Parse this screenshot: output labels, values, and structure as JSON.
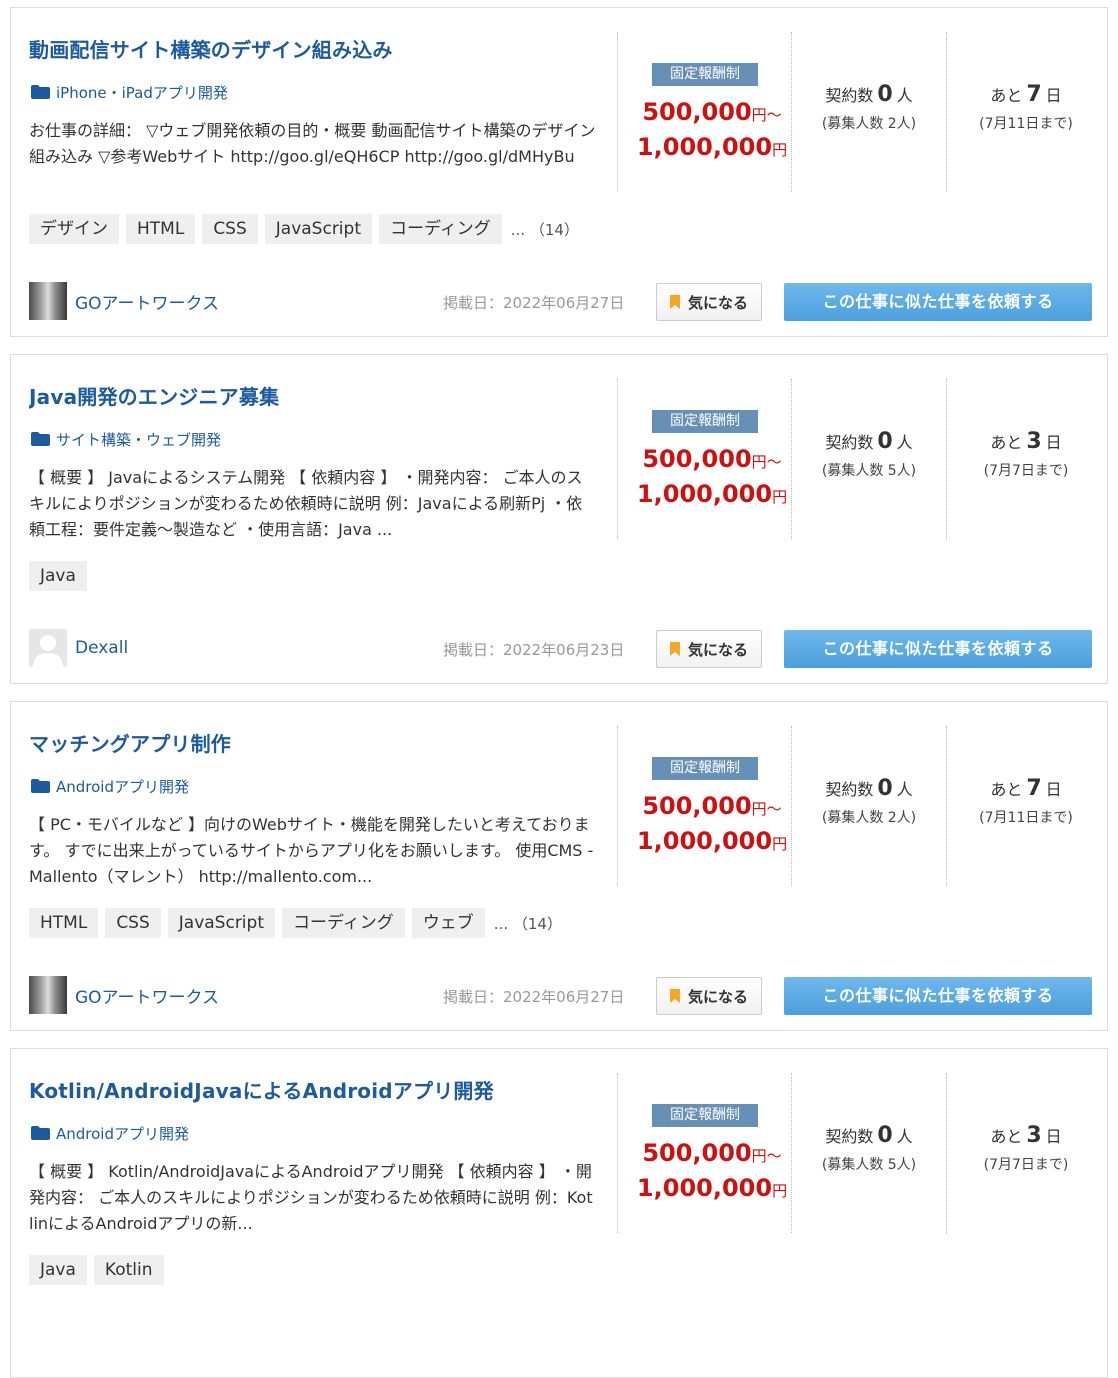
{
  "common": {
    "fee_type": "固定報酬制",
    "price_min": "500,000",
    "price_max": "1,000,000",
    "yen": "円",
    "tilde": "～",
    "contracts_label": "契約数",
    "people_unit": "人",
    "remaining_prefix": "あと",
    "days_unit": "日",
    "favorite_label": "気になる",
    "request_similar_label": "この仕事に似た仕事を依頼する"
  },
  "jobs": [
    {
      "title": "動画配信サイト構築のデザイン組み込み",
      "category": "iPhone・iPadアプリ開発",
      "description": "お仕事の詳細： ▽ウェブ開発依頼の目的・概要 動画配信サイト構築のデザイン組み込み ▽参考Webサイト http://goo.gl/eQH6CP http://goo.gl/dMHyBu",
      "tags": [
        "デザイン",
        "HTML",
        "CSS",
        "JavaScript",
        "コーディング"
      ],
      "tag_more": "... （14）",
      "contracts": "0",
      "recruit": "(募集人数 2人)",
      "days_left": "7",
      "deadline": "(7月11日まで)",
      "client": "GOアートワークス",
      "posted": "掲載日：2022年06月27日"
    },
    {
      "title": "Java開発のエンジニア募集",
      "category": "サイト構築・ウェブ開発",
      "description": "【 概要 】 Javaによるシステム開発 【 依頼内容 】 ・開発内容： ご本人のスキルによりポジションが変わるため依頼時に説明 例：Javaによる刷新Pj ・依頼工程：要件定義〜製造など ・使用言語：Java ...",
      "tags": [
        "Java"
      ],
      "tag_more": "",
      "contracts": "0",
      "recruit": "(募集人数 5人)",
      "days_left": "3",
      "deadline": "(7月7日まで)",
      "client": "Dexall",
      "posted": "掲載日：2022年06月23日"
    },
    {
      "title": "マッチングアプリ制作",
      "category": "Androidアプリ開発",
      "description": "【 PC・モバイルなど 】向けのWebサイト・機能を開発したいと考えております。 すでに出来上がっているサイトからアプリ化をお願いします。 使用CMS - Mallento（マレント） http://mallento.com...",
      "tags": [
        "HTML",
        "CSS",
        "JavaScript",
        "コーディング",
        "ウェブ"
      ],
      "tag_more": "... （14）",
      "contracts": "0",
      "recruit": "(募集人数 2人)",
      "days_left": "7",
      "deadline": "(7月11日まで)",
      "client": "GOアートワークス",
      "posted": "掲載日：2022年06月27日"
    },
    {
      "title": "Kotlin/AndroidJavaによるAndroidアプリ開発",
      "category": "Androidアプリ開発",
      "description": "【 概要 】 Kotlin/AndroidJavaによるAndroidアプリ開発 【 依頼内容 】 ・開発内容： ご本人のスキルによりポジションが変わるため依頼時に説明 例：KotlinによるAndroidアプリの新...",
      "tags": [
        "Java",
        "Kotlin"
      ],
      "tag_more": "",
      "contracts": "0",
      "recruit": "(募集人数 5人)",
      "days_left": "3",
      "deadline": "(7月7日まで)",
      "client": "",
      "posted": ""
    }
  ],
  "colors": {
    "link": "#1d5a9e",
    "price": "#cc1111",
    "badge": "#6790b7",
    "request_button": "#4b9fdd",
    "bookmark": "#f5a623"
  },
  "avatars": [
    "photo-avatar",
    "default-avatar",
    "photo-avatar",
    ""
  ]
}
